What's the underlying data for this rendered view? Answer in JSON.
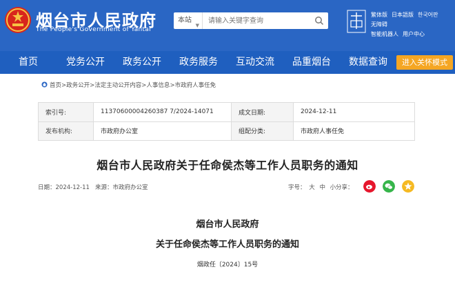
{
  "header": {
    "title": "烟台市人民政府",
    "subtitle": "The People's Government of Yantai",
    "search": {
      "scope": "本站",
      "placeholder": "请输入关键字查询"
    },
    "top_links": [
      "繁体版",
      "日本語版",
      "한국어판",
      "无障碍",
      "智能机器人",
      "用户中心"
    ]
  },
  "nav": {
    "items": [
      "首页",
      "党务公开",
      "政务公开",
      "政务服务",
      "互动交流",
      "品重烟台",
      "数据查询"
    ],
    "care_mode": "进入关怀模式"
  },
  "breadcrumb": [
    "首页",
    "政务公开",
    "法定主动公开内容",
    "人事信息",
    "市政府人事任免"
  ],
  "info": {
    "index_label": "索引号:",
    "index_value": "11370600004260387 7/2024-14071",
    "date_label": "成文日期:",
    "date_value": "2024-12-11",
    "publisher_label": "发布机构:",
    "publisher_value": "市政府办公室",
    "category_label": "组配分类:",
    "category_value": "市政府人事任免"
  },
  "doc": {
    "title": "烟台市人民政府关于任命侯杰等工作人员职务的通知",
    "date_text": "日期：2024-12-11",
    "source_text": "来源：市政府办公室",
    "font_size_label": "字号：",
    "font_sizes": [
      "大",
      "中",
      "小"
    ],
    "share_label": "分享：",
    "org": "烟台市人民政府",
    "body_title": "关于任命侯杰等工作人员职务的通知",
    "doc_no": "烟政任〔2024〕15号"
  },
  "colors": {
    "header_blue": "#2a66c4",
    "nav_blue": "#1f5fbf",
    "care_orange": "#f5a623",
    "weibo_red": "#e6162d",
    "wechat_green": "#36b54a",
    "qzone_yellow": "#f5b922"
  },
  "icons": {
    "search": "search-icon",
    "home": "home-icon",
    "weibo": "weibo-icon",
    "wechat": "wechat-icon",
    "qzone": "qzone-icon"
  }
}
